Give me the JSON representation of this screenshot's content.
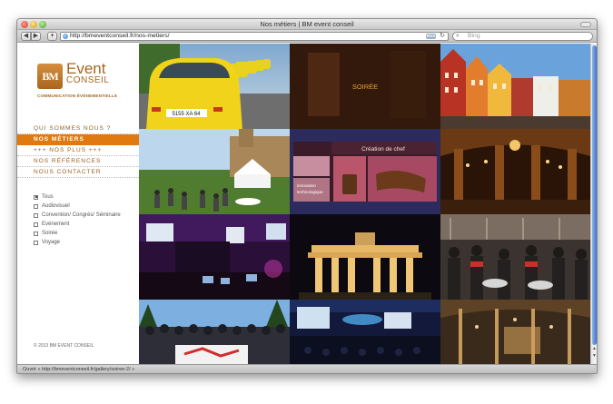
{
  "window": {
    "title": "Nos métiers | BM event conseil"
  },
  "toolbar": {
    "back_label": "◀",
    "forward_label": "▶",
    "add_label": "+",
    "url": "http://bmeventconseil.fr/nos-metiers/",
    "rss_label": "RSS",
    "search_placeholder": "Bing"
  },
  "logo": {
    "mark": "BM",
    "name_line1": "Event",
    "name_line2": "CONSEIL",
    "tagline": "COMMUNICATION ÉVÉNEMENTIELLE"
  },
  "nav": {
    "items": [
      {
        "label": "QUI SOMMES NOUS ?",
        "active": false
      },
      {
        "label": "NOS MÉTIERS",
        "active": true
      },
      {
        "label": "+++ NOS PLUS +++",
        "active": false
      },
      {
        "label": "NOS RÉFÉRENCES",
        "active": false
      },
      {
        "label": "NOUS CONTACTER",
        "active": false
      }
    ]
  },
  "filters": {
    "items": [
      {
        "label": "Tous",
        "checked": true
      },
      {
        "label": "Audiovisuel",
        "checked": false
      },
      {
        "label": "Convention/ Congrès/ Séminaire",
        "checked": false
      },
      {
        "label": "Evénement",
        "checked": false
      },
      {
        "label": "Soirée",
        "checked": false
      },
      {
        "label": "Voyage",
        "checked": false
      }
    ]
  },
  "footer": {
    "copyright": "© 2013 BM EVENT CONSEIL"
  },
  "gallery": {
    "tile_soiree_caption": "SOIRÉE",
    "tile_plate": "5155 XA 64",
    "tile_chef_title": "Création de chef",
    "tile_chef_tagline_1": "innovation",
    "tile_chef_tagline_2": "technologique"
  },
  "status": {
    "text": "Ouvrir « http://bmeventconseil.fr/gallery/soiree-2/ »"
  },
  "colors": {
    "accent": "#e07a10",
    "brand": "#a7651f"
  }
}
